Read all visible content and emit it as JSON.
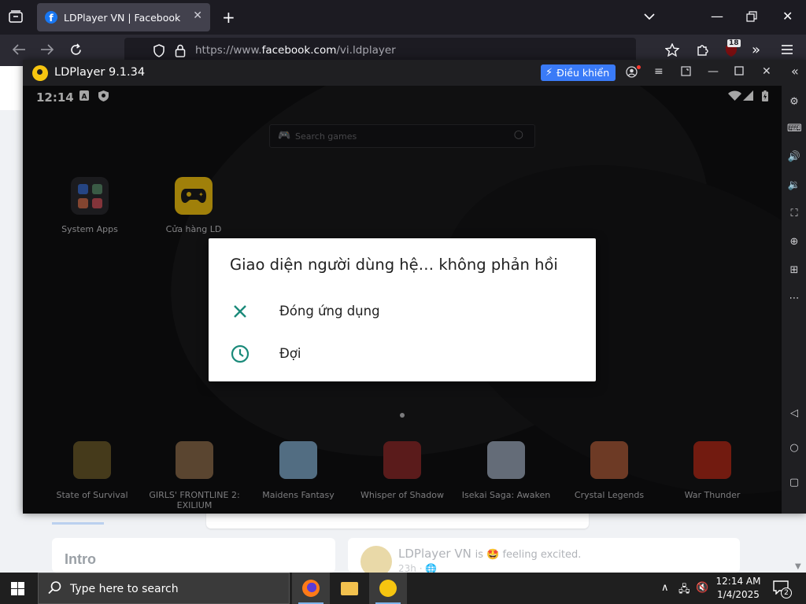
{
  "browser": {
    "tab_title": "LDPlayer VN | Facebook",
    "tab_favicon": "f",
    "url_prefix": "https://www.",
    "url_host": "facebook.com",
    "url_path": "/vi.ldplayer",
    "extension_badge": "18"
  },
  "facebook": {
    "intro_heading": "Intro",
    "post_author": "LDPlayer VN",
    "post_action": "is 🤩 feeling excited.",
    "post_meta": "23h · 🌐"
  },
  "ldplayer": {
    "title": "LDPlayer 9.1.34",
    "control_button": "Điều khiển",
    "accent": "#3a7bf7"
  },
  "android": {
    "time": "12:14",
    "search_placeholder": "Search games",
    "apps": [
      {
        "label": "System Apps"
      },
      {
        "label": "Cửa hàng LD"
      }
    ],
    "dock": [
      {
        "label": "State of Survival",
        "color": "#6b5a2a"
      },
      {
        "label": "GIRLS' FRONTLINE 2: EXILIUM",
        "color": "#8a6a4a"
      },
      {
        "label": "Maidens Fantasy",
        "color": "#7fa8c8"
      },
      {
        "label": "Whisper of Shadow",
        "color": "#8a2a2a"
      },
      {
        "label": "Isekai Saga: Awaken",
        "color": "#9aa6b8"
      },
      {
        "label": "Crystal Legends",
        "color": "#a85a3a"
      },
      {
        "label": "War Thunder",
        "color": "#b02a1a"
      }
    ]
  },
  "dialog": {
    "title": "Giao diện người dùng hệ… không phản hồi",
    "close_app": "Đóng ứng dụng",
    "wait": "Đợi",
    "icon_color": "#1a8a7a"
  },
  "taskbar": {
    "search_placeholder": "Type here to search",
    "time": "12:14 AM",
    "date": "1/4/2025",
    "notification_count": "2"
  }
}
